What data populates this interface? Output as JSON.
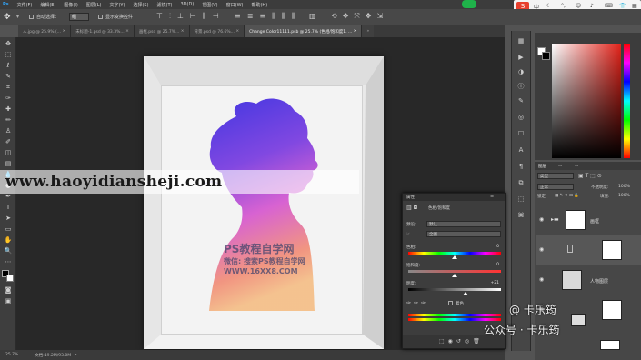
{
  "menubar": {
    "items": [
      "Ps",
      "文件(F)",
      "编辑(E)",
      "图像(I)",
      "图层(L)",
      "文字(Y)",
      "选择(S)",
      "滤镜(T)",
      "3D(D)",
      "视图(V)",
      "窗口(W)",
      "帮助(H)"
    ]
  },
  "options_bar": {
    "auto_select_label": "自动选择：",
    "auto_select_value": "组",
    "show_transform_label": "显示变换控件"
  },
  "tabs": [
    {
      "label": "人.jpg @ 25.9% (..."
    },
    {
      "label": "未标题-1.psd @ 33.3%..."
    },
    {
      "label": "画框.psd @ 25.7%..."
    },
    {
      "label": "背景.psd @ 76.6%..."
    },
    {
      "label": "Change Color11111.psb @ 25.7% (色相/饱和度1, ..."
    }
  ],
  "canvas": {
    "watermark_url": "www.haoyidiansheji.com",
    "watermark_cn_1": "PS教程自学网",
    "watermark_cn_2": "微信: 搜索PS教程自学网",
    "watermark_cn_3": "WWW.16XX8.COM"
  },
  "statusbar": {
    "zoom": "25.7%",
    "doc": "文档:19.2M/93.0M"
  },
  "properties_panel": {
    "title": "属性",
    "adjustment": "色相/饱和度",
    "preset_label": "预设:",
    "preset_value": "默认",
    "channel_value": "全图",
    "hue_label": "色相:",
    "hue_value": "0",
    "sat_label": "饱和度:",
    "sat_value": "0",
    "light_label": "明度:",
    "light_value": "+21",
    "colorize_label": "着色"
  },
  "layers_panel": {
    "tab_label": "图层",
    "kind_label": "类型",
    "mode_label": "正常",
    "opacity_label": "不透明度:",
    "opacity_value": "100%",
    "lock_label": "锁定:",
    "fill_label": "填充:",
    "fill_value": "100%",
    "layers": [
      {
        "name": "画框"
      },
      {
        "name": ""
      },
      {
        "name": "人物图层"
      },
      {
        "name": ""
      }
    ]
  },
  "signature": {
    "line1": "@ 卡乐筠",
    "line2": "公众号 · 卡乐筠"
  },
  "colors": {
    "accent_green": "#1fb24a",
    "panel_dark": "#3c3c3c"
  }
}
